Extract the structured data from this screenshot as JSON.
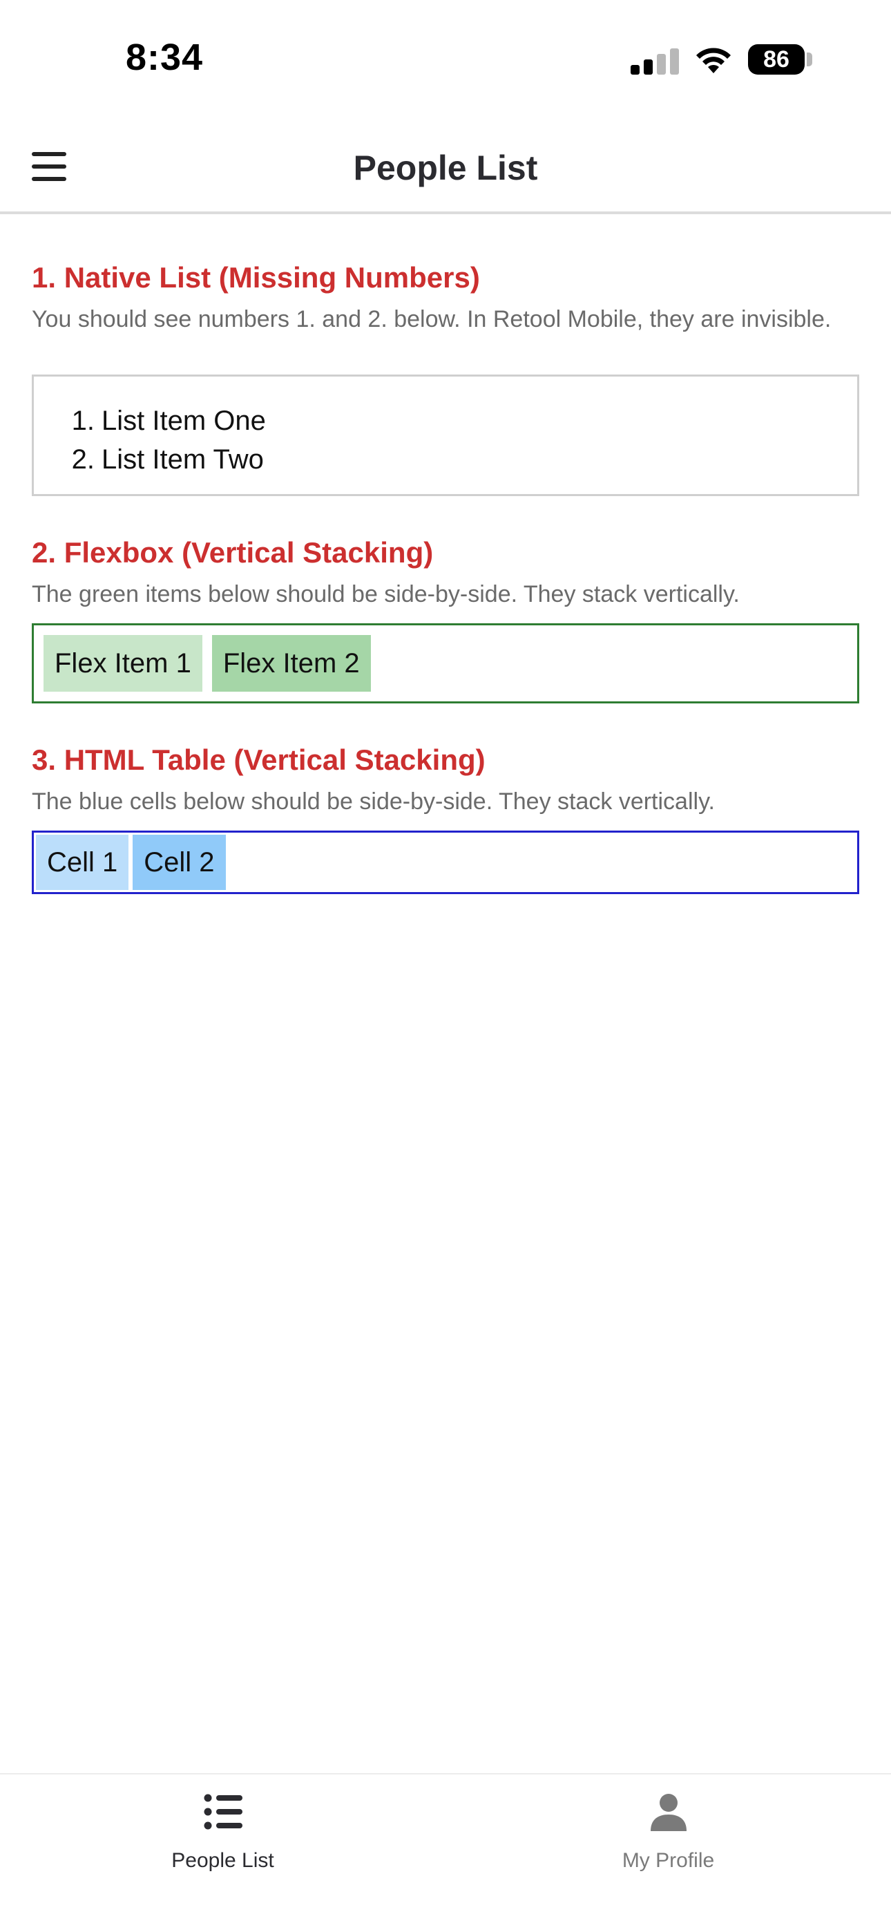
{
  "status_bar": {
    "time": "8:34",
    "battery": "86"
  },
  "header": {
    "title": "People List"
  },
  "sections": {
    "native_list": {
      "title": "1. Native List (Missing Numbers)",
      "description": "You should see numbers 1. and 2. below. In Retool Mobile, they are invisible.",
      "items": [
        {
          "num": "1.",
          "label": "List Item One"
        },
        {
          "num": "2.",
          "label": "List Item Two"
        }
      ]
    },
    "flexbox": {
      "title": "2. Flexbox (Vertical Stacking)",
      "description": "The green items below should be side-by-side. They stack vertically.",
      "items": [
        "Flex Item 1",
        "Flex Item 2"
      ],
      "colors": {
        "border": "#2e7d32",
        "item1": "#c8e6c9",
        "item2": "#a5d6a7"
      }
    },
    "table": {
      "title": "3. HTML Table (Vertical Stacking)",
      "description": "The blue cells below should be side-by-side. They stack vertically.",
      "cells": [
        "Cell 1",
        "Cell 2"
      ],
      "colors": {
        "border": "#2222cc",
        "cell1": "#bbdefb",
        "cell2": "#90caf9"
      }
    }
  },
  "tab_bar": {
    "tabs": [
      {
        "label": "People List",
        "icon": "list-icon",
        "active": true
      },
      {
        "label": "My Profile",
        "icon": "person-icon",
        "active": false
      }
    ],
    "colors": {
      "active": "#2b2b30",
      "inactive": "#7a7a7a"
    }
  },
  "colors": {
    "section_title": "#cc2f2f",
    "description": "#6a6a6a"
  }
}
